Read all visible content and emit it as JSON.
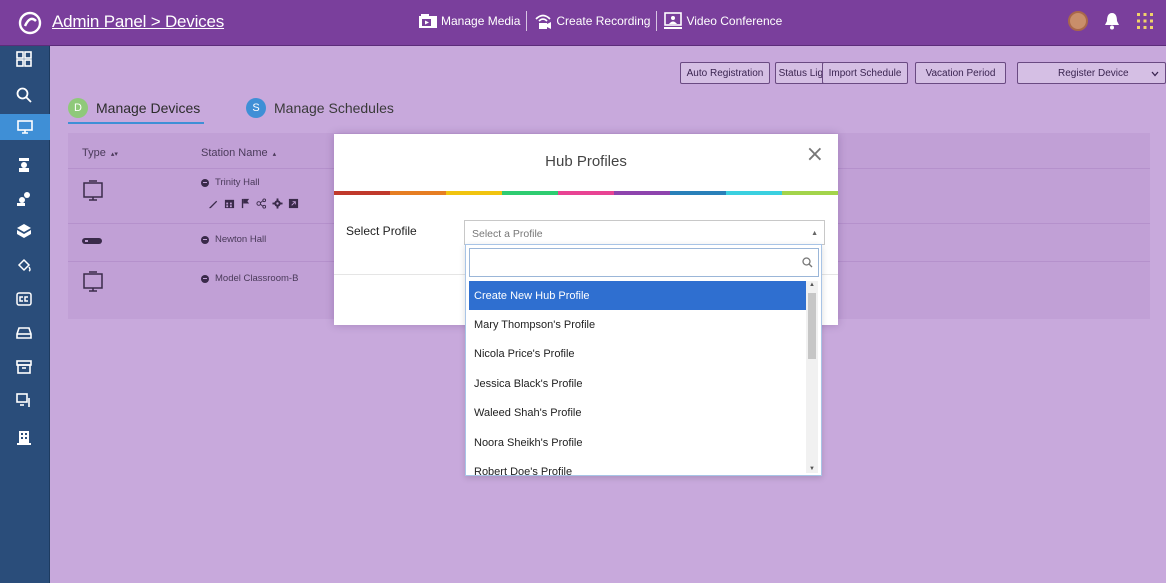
{
  "header": {
    "breadcrumb": "Admin Panel > Devices",
    "nav": [
      {
        "label": "Manage Media",
        "icon": "media-icon"
      },
      {
        "label": "Create Recording",
        "icon": "recording-icon"
      },
      {
        "label": "Video Conference",
        "icon": "video-conference-icon"
      }
    ],
    "right_icons": [
      "avatar",
      "bell-icon",
      "apps-grid-icon"
    ]
  },
  "sidebar": {
    "items": [
      "dashboard-icon",
      "search-icon",
      "devices-icon",
      "users-icon",
      "groups-icon",
      "box-icon",
      "paint-icon",
      "captions-icon",
      "storage-icon",
      "archive-icon",
      "monitor-icon",
      "building-icon"
    ],
    "active_index": 2
  },
  "toolbar": {
    "auto_registration": "Auto Registration",
    "status_light": "Status Light",
    "import_schedule": "Import Schedule",
    "vacation_period": "Vacation Period",
    "register_device": "Register Device"
  },
  "tabs": [
    {
      "badge": "D",
      "label": "Manage Devices",
      "active": true
    },
    {
      "badge": "S",
      "label": "Manage Schedules",
      "active": false
    }
  ],
  "table": {
    "columns": [
      "Type",
      "Station Name"
    ],
    "rows": [
      {
        "type": "display",
        "station": "Trinity Hall"
      },
      {
        "type": "hub",
        "station": "Newton Hall"
      },
      {
        "type": "display",
        "station": "Model Classroom-B"
      }
    ]
  },
  "modal": {
    "title": "Hub Profiles",
    "close": "×",
    "select_label": "Select Profile",
    "select_placeholder": "Select a Profile",
    "rainbow": [
      "#c0392b",
      "#e67e22",
      "#f1c40f",
      "#2ecc71",
      "#e84393",
      "#8e44ad",
      "#2980b9",
      "#3ad0e0",
      "#a3d44b"
    ]
  },
  "dropdown": {
    "search_value": "",
    "highlighted_index": 0,
    "options": [
      "Create New Hub Profile",
      "Mary Thompson's Profile",
      "Nicola Price's Profile",
      "Jessica Black's Profile",
      "Waleed Shah's Profile",
      "Noora Sheikh's Profile",
      "Robert Doe's Profile"
    ]
  }
}
